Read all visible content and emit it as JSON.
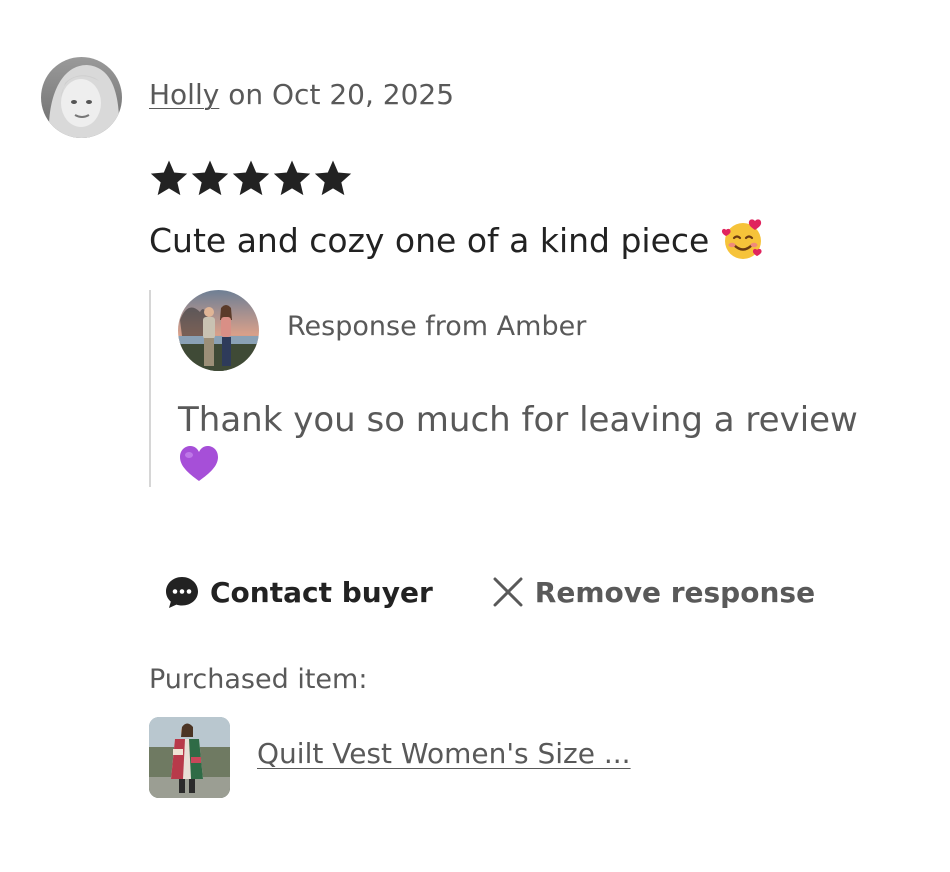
{
  "review": {
    "reviewer_name": "Holly",
    "date_text": " on Oct 20, 2025",
    "rating": 5,
    "rating_max": 5,
    "text": "Cute and cozy one of a kind piece",
    "emoji_icon": "smiling-face-with-hearts-icon"
  },
  "response": {
    "from_label": "Response from Amber",
    "text": "Thank you so much for leaving a review",
    "emoji_icon": "purple-heart-icon"
  },
  "actions": {
    "contact_label": "Contact buyer",
    "remove_label": "Remove response"
  },
  "purchased": {
    "label": "Purchased item:",
    "item_title": "Quilt Vest Women's Size ..."
  },
  "colors": {
    "text_primary": "#222222",
    "text_secondary": "#595959",
    "star": "#222222",
    "divider": "#d6d6d6",
    "heart": "#a64fd8"
  }
}
